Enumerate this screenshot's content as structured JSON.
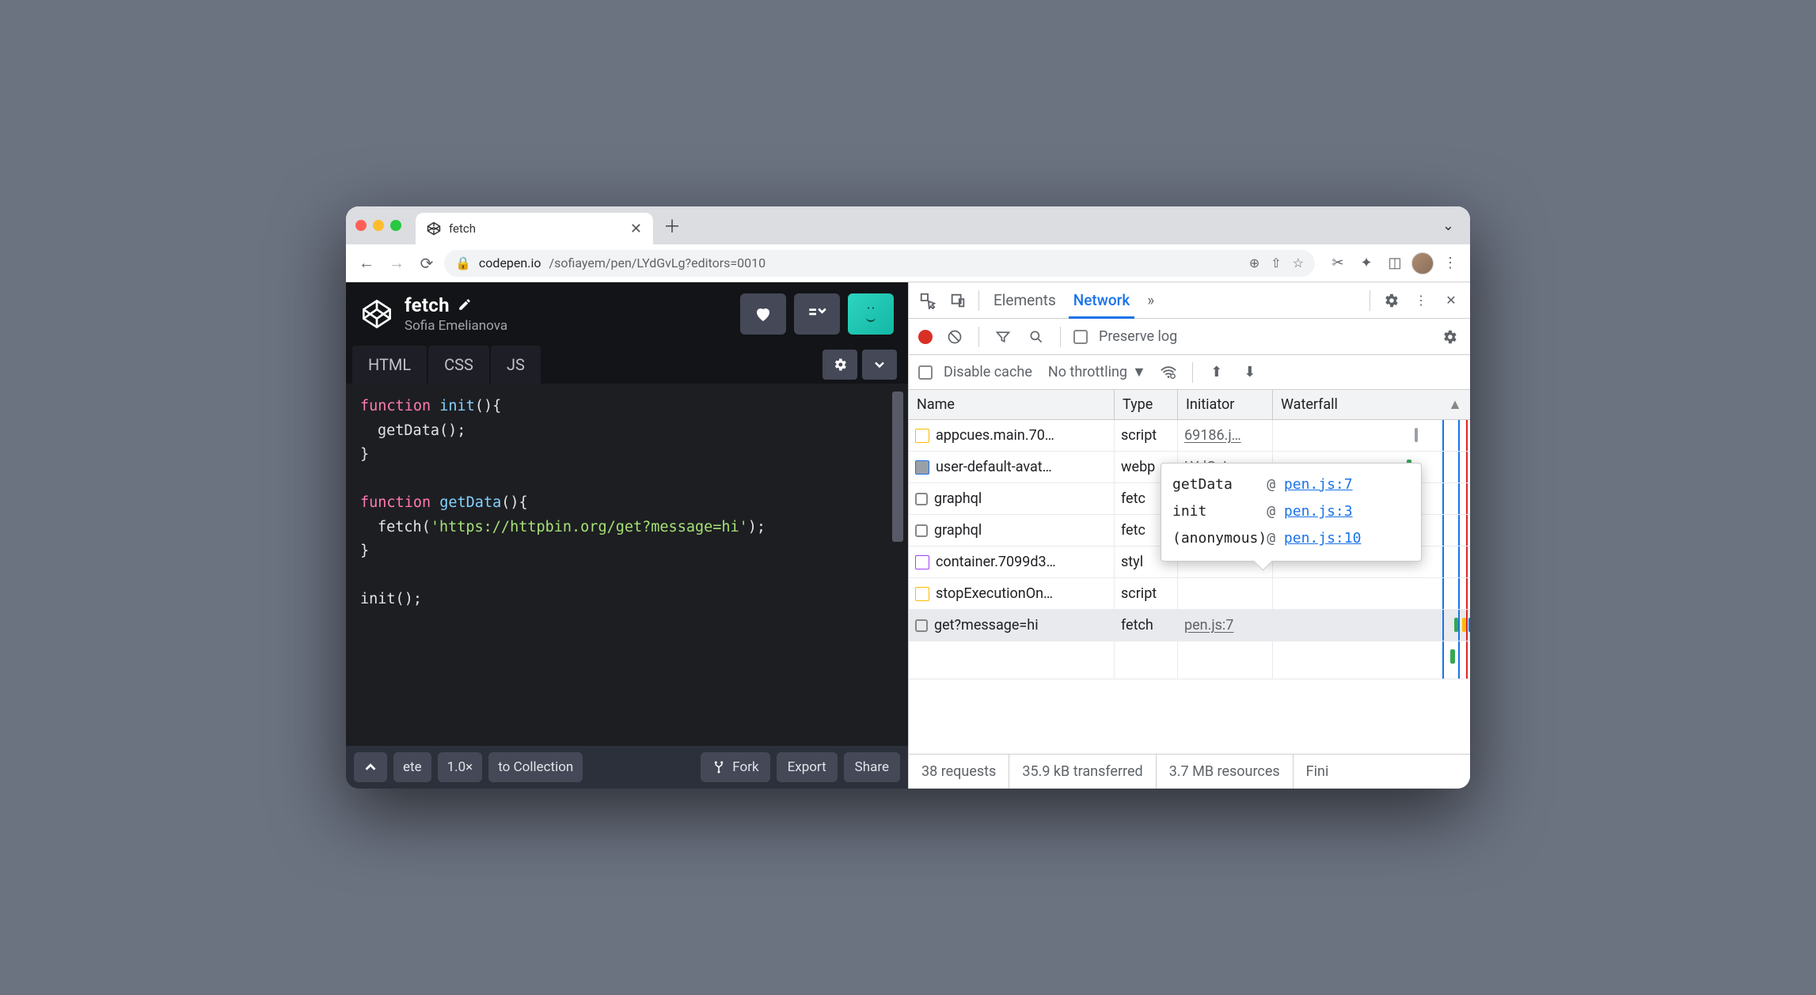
{
  "browser": {
    "tab_title": "fetch",
    "url_host": "codepen.io",
    "url_path": "/sofiayem/pen/LYdGvLg?editors=0010"
  },
  "codepen": {
    "title": "fetch",
    "author": "Sofia Emelianova",
    "tabs": {
      "html": "HTML",
      "css": "CSS",
      "js": "JS"
    },
    "code": {
      "l1a": "function",
      "l1b": "init",
      "l1c": "(){",
      "l2": "getData();",
      "l3": "}",
      "l4a": "function",
      "l4b": "getData",
      "l4c": "(){",
      "l5a": "fetch(",
      "l5b": "'https://httpbin.org/get?message=hi'",
      "l5c": ");",
      "l6": "}",
      "l7": "init();"
    },
    "footer": {
      "frag1": "ete",
      "zoom": "1.0×",
      "to_collection": "to Collection",
      "fork": "Fork",
      "export": "Export",
      "share": "Share"
    }
  },
  "devtools": {
    "tabs": {
      "elements": "Elements",
      "network": "Network",
      "more": "»"
    },
    "toolbar": {
      "preserve": "Preserve log",
      "disable_cache": "Disable cache",
      "throttling": "No throttling"
    },
    "columns": {
      "name": "Name",
      "type": "Type",
      "initiator": "Initiator",
      "waterfall": "Waterfall"
    },
    "rows": [
      {
        "icon": "js",
        "name": "appcues.main.70…",
        "type": "script",
        "initiator": "69186.j…"
      },
      {
        "icon": "img",
        "name": "user-default-avat…",
        "type": "webp",
        "initiator": "LYdGvL…"
      },
      {
        "icon": "none",
        "name": "graphql",
        "type": "fetc",
        "initiator": ""
      },
      {
        "icon": "none",
        "name": "graphql",
        "type": "fetc",
        "initiator": ""
      },
      {
        "icon": "css",
        "name": "container.7099d3…",
        "type": "styl",
        "initiator": ""
      },
      {
        "icon": "js",
        "name": "stopExecutionOn…",
        "type": "script",
        "initiator": ""
      },
      {
        "icon": "none",
        "name": "get?message=hi",
        "type": "fetch",
        "initiator": "pen.js:7"
      }
    ],
    "tooltip": [
      {
        "fn": "getData",
        "loc": "pen.js:7"
      },
      {
        "fn": "init",
        "loc": "pen.js:3"
      },
      {
        "fn": "(anonymous)",
        "loc": "pen.js:10"
      }
    ],
    "status": {
      "requests": "38 requests",
      "transferred": "35.9 kB transferred",
      "resources": "3.7 MB resources",
      "finish": "Fini"
    }
  }
}
